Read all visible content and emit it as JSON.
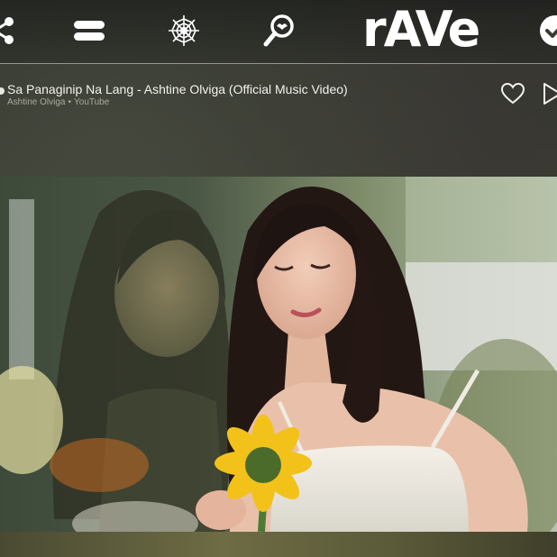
{
  "app": {
    "logo_text": "rAVe",
    "nav": [
      {
        "id": "share",
        "icon": "share-nodes-icon"
      },
      {
        "id": "menu",
        "icon": "menu-icon"
      },
      {
        "id": "web",
        "icon": "spider-web-icon"
      },
      {
        "id": "search",
        "icon": "search-icon"
      },
      {
        "id": "check",
        "icon": "check-circle-icon"
      }
    ]
  },
  "now_playing": {
    "title": "Sa Panaginip Na Lang - Ashtine Olviga (Official Music Video)",
    "channel": "Ashtine Olviga",
    "separator": "•",
    "source": "YouTube"
  },
  "colors": {
    "text": "#f2f2ee",
    "subtext": "#a9aa9c",
    "divider": "#ffffff"
  }
}
